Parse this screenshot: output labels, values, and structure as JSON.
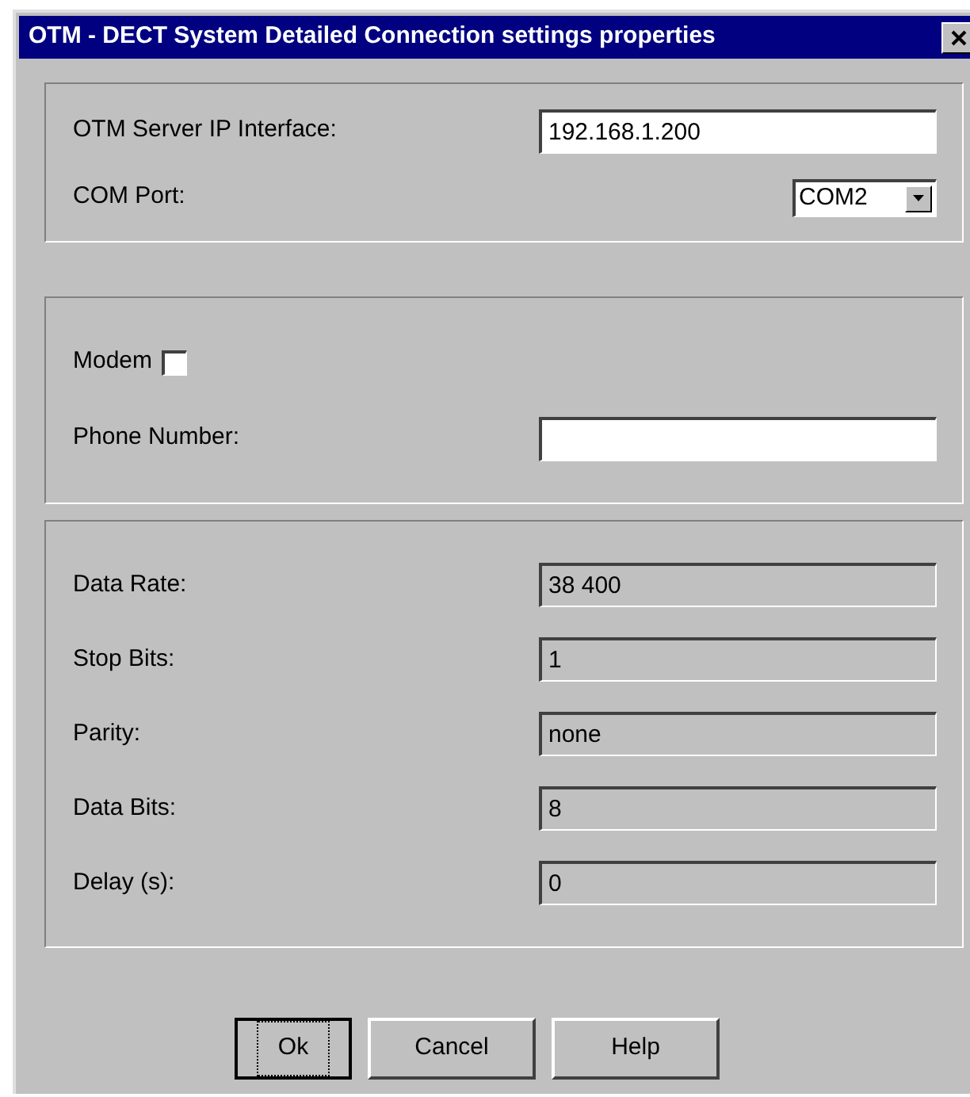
{
  "window": {
    "title": "OTM - DECT System Detailed Connection settings properties"
  },
  "server": {
    "ip_label": "OTM Server IP Interface:",
    "ip_value": "192.168.1.200",
    "com_label": "COM Port:",
    "com_value": "COM2"
  },
  "modem": {
    "label": "Modem",
    "checked": false,
    "phone_label": "Phone Number:"
  },
  "serial_fields": [
    {
      "label": "Data Rate:",
      "value": "38 400",
      "disabled": true
    },
    {
      "label": "Stop Bits:",
      "value": "1",
      "disabled": true
    },
    {
      "label": "Parity:",
      "value": "none",
      "disabled": true
    },
    {
      "label": "Data Bits:",
      "value": "8",
      "disabled": true
    },
    {
      "label": "Delay (s):",
      "value": "0",
      "disabled": true
    }
  ],
  "buttons": [
    {
      "label": "Ok",
      "focused": true
    },
    {
      "label": "Cancel",
      "focused": false
    },
    {
      "label": "Help",
      "focused": false
    }
  ]
}
